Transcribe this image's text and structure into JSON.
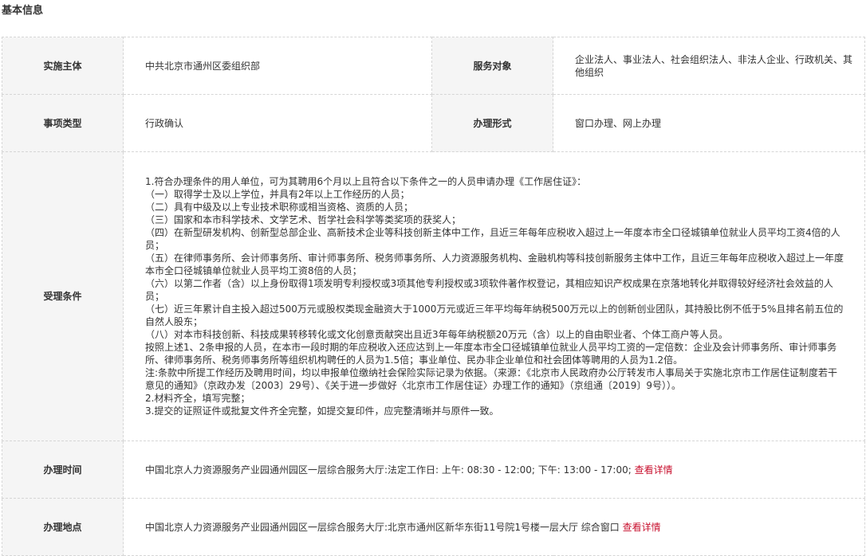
{
  "section": {
    "title": "基本信息"
  },
  "rows": {
    "implementer": {
      "label": "实施主体",
      "value": "中共北京市通州区委组织部"
    },
    "service_target": {
      "label": "服务对象",
      "value": "企业法人、事业法人、社会组织法人、非法人企业、行政机关、其他组织"
    },
    "item_type": {
      "label": "事项类型",
      "value": "行政确认"
    },
    "handling_form": {
      "label": "办理形式",
      "value": "窗口办理、网上办理"
    },
    "conditions": {
      "label": "受理条件",
      "lines": [
        "1.符合办理条件的用人单位，可为其聘用6个月以上且符合以下条件之一的人员申请办理《工作居住证》：",
        "（一）取得学士及以上学位，并具有2年以上工作经历的人员；",
        "（二）具有中级及以上专业技术职称或相当资格、资质的人员；",
        "（三）国家和本市科学技术、文学艺术、哲学社会科学等类奖项的获奖人；",
        "（四）在新型研发机构、创新型总部企业、高新技术企业等科技创新主体中工作，且近三年每年应税收入超过上一年度本市全口径城镇单位就业人员平均工资4倍的人员；",
        "（五）在律师事务所、会计师事务所、审计师事务所、税务师事务所、人力资源服务机构、金融机构等科技创新服务主体中工作，且近三年每年应税收入超过上一年度本市全口径城镇单位就业人员平均工资8倍的人员；",
        "（六）以第二作者（含）以上身份取得1项发明专利授权或3项其他专利授权或3项软件著作权登记，其相应知识产权成果在京落地转化并取得较好经济社会效益的人员；",
        "（七）近三年累计自主投入超过500万元或股权类现金融资大于1000万元或近三年平均每年纳税500万元以上的创新创业团队，其持股比例不低于5%且排名前五位的自然人股东；",
        "（八）对本市科技创新、科技成果转移转化或文化创意贡献突出且近3年每年纳税额20万元（含）以上的自由职业者、个体工商户等人员。",
        "按照上述1、2条申报的人员，在本市一段时期的年应税收入还应达到上一年度本市全口径城镇单位就业人员平均工资的一定倍数：企业及会计师事务所、审计师事务所、律师事务所、税务师事务所等组织机构聘任的人员为1.5倍；事业单位、民办非企业单位和社会团体等聘用的人员为1.2倍。",
        "注:条款中所提工作经历及聘用时间，均以申报单位缴纳社会保险实际记录为依据。（来源：《北京市人民政府办公厅转发市人事局关于实施北京市工作居住证制度若干意见的通知》（京政办发〔2003〕29号）、《关于进一步做好〈北京市工作居住证〉办理工作的通知》（京组通〔2019〕9号））。",
        "2.材料齐全，填写完整；",
        "3.提交的证照证件或批复文件齐全完整，如提交复印件，应完整清晰并与原件一致。"
      ]
    },
    "hours": {
      "label": "办理时间",
      "value": "中国北京人力资源服务产业园通州园区一层综合服务大厅:法定工作日: 上午: 08:30 - 12:00; 下午: 13:00 - 17:00;",
      "link": "查看详情"
    },
    "location": {
      "label": "办理地点",
      "value": "中国北京人力资源服务产业园通州园区一层综合服务大厅:北京市通州区新华东街11号院1号楼一层大厅 综合窗口",
      "link": "查看详情"
    }
  },
  "colors": {
    "label_bg": "#f5f5f5",
    "border": "#d6d6d6",
    "link": "#c8102e",
    "text": "#333333"
  }
}
